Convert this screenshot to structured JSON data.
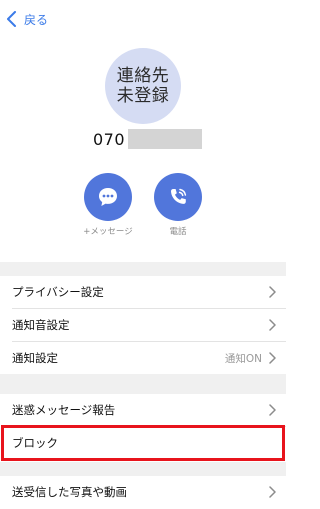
{
  "header": {
    "back_label": "戻る"
  },
  "contact": {
    "avatar_line1": "連絡先",
    "avatar_line2": "未登録",
    "number_prefix": "070"
  },
  "actions": {
    "message_label": "+メッセージ",
    "call_label": "電話"
  },
  "menu": {
    "privacy": "プライバシー設定",
    "notification_sound": "通知音設定",
    "notification": "通知設定",
    "notification_value": "通知ON",
    "spam_report": "迷惑メッセージ報告",
    "block": "ブロック",
    "media": "送受信した写真や動画"
  },
  "colors": {
    "accent": "#5176db",
    "link": "#3b7be8",
    "highlight": "#e8141c",
    "avatar_bg": "#d5dcf3"
  }
}
